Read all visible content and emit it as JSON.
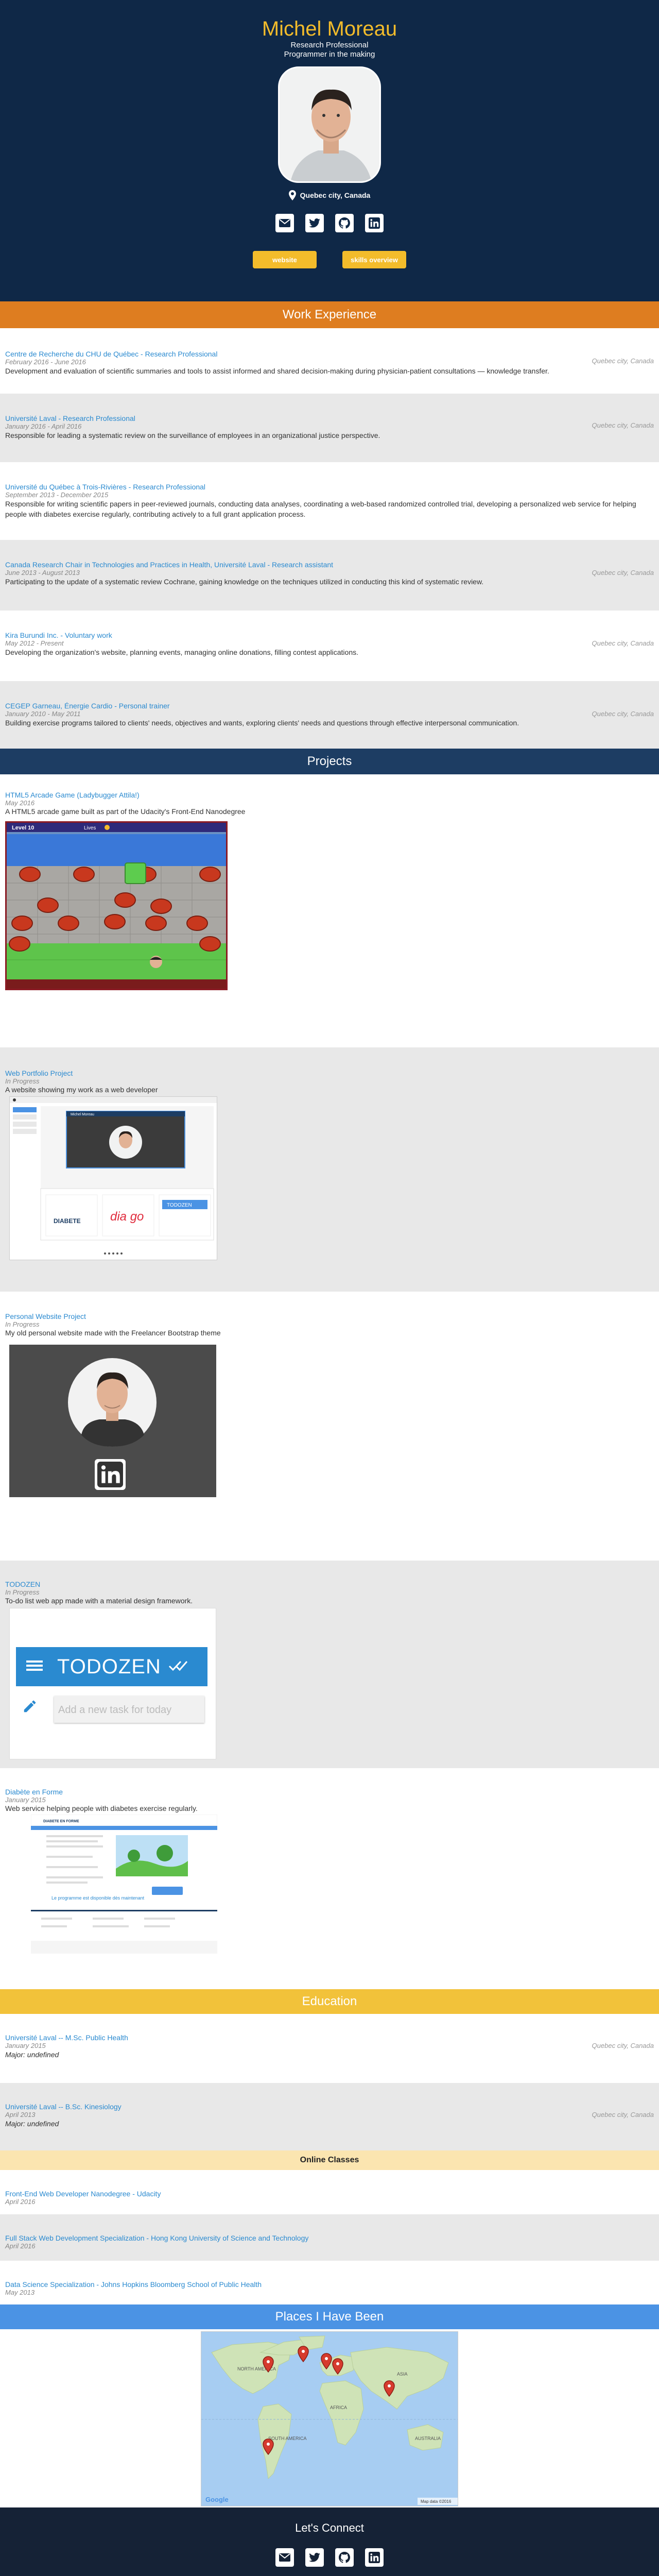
{
  "header": {
    "name": "Michel Moreau",
    "tagline1": "Research Professional",
    "tagline2": "Programmer in the making",
    "location": "Quebec city, Canada",
    "socials": [
      "email-icon",
      "twitter-icon",
      "github-icon",
      "linkedin-icon"
    ],
    "buttons": [
      "website",
      "skills overview"
    ]
  },
  "work": {
    "heading": "Work Experience",
    "items": [
      {
        "title": "Centre de Recherche du CHU de Québec - Research Professional",
        "date": "February 2016 - June 2016",
        "location": "Quebec city, Canada",
        "desc": "Development and evaluation of scientific summaries and tools to assist informed and shared decision-making during physician-patient consultations — knowledge transfer."
      },
      {
        "title": "Université Laval - Research Professional",
        "date": "January 2016 - April 2016",
        "location": "Quebec city, Canada",
        "desc": "Responsible for leading a systematic review on the surveillance of employees in an organizational justice perspective."
      },
      {
        "title": "Université du Québec à Trois-Rivières - Research Professional",
        "date": "September 2013 - December 2015",
        "location": "",
        "desc": "Responsible for writing scientific papers in peer-reviewed journals, conducting data analyses, coordinating a web-based randomized controlled trial, developing a personalized web service for helping people with diabetes exercise regularly, contributing actively to a full grant application process."
      },
      {
        "title": "Canada Research Chair in Technologies and Practices in Health, Université Laval - Research assistant",
        "date": "June 2013 - August 2013",
        "location": "Quebec city, Canada",
        "desc": "Participating to the update of a systematic review Cochrane, gaining knowledge on the techniques utilized in conducting this kind of systematic review."
      },
      {
        "title": "Kira Burundi Inc. - Voluntary work",
        "date": "May 2012 - Present",
        "location": "Quebec city, Canada",
        "desc": "Developing the organization's website, planning events, managing online donations, filling contest applications."
      },
      {
        "title": "CEGEP Garneau, Énergie Cardio - Personal trainer",
        "date": "January 2010 - May 2011",
        "location": "Quebec city, Canada",
        "desc": "Building exercise programs tailored to clients' needs, objectives and wants, exploring clients' needs and questions through effective interpersonal communication."
      }
    ]
  },
  "projects": {
    "heading": "Projects",
    "items": [
      {
        "title": "HTML5 Arcade Game (Ladybugger Attila!)",
        "status": "May 2016",
        "desc": "A HTML5 arcade game built as part of the Udacity's Front-End Nanodegree",
        "level": "Level 10",
        "lives": "Lives"
      },
      {
        "title": "Web Portfolio Project",
        "status": "In Progress",
        "desc": "A website showing my work as a web developer",
        "shot_header": "Michel Moreau",
        "shot_logo1": "DIABETE",
        "shot_logo2": "dia go",
        "shot_logo3": "TODOZEN"
      },
      {
        "title": "Personal Website Project",
        "status": "In Progress",
        "desc": "My old personal website made with the Freelancer Bootstrap theme"
      },
      {
        "title": "TODOZEN",
        "status": "In Progress",
        "desc": "To-do list web app made with a material design framework.",
        "app_title": "TODOZEN",
        "input_placeholder": "Add a new task for today"
      },
      {
        "title": "Diabète en Forme",
        "status": "January 2015",
        "desc": "Web service helping people with diabetes exercise regularly.",
        "shot_brand": "DIABETE EN FORME",
        "shot_text": "Le programme est disponible dès maintenant"
      }
    ]
  },
  "education": {
    "heading": "Education",
    "items": [
      {
        "title": "Université Laval -- M.Sc. Public Health",
        "date": "January 2015",
        "location": "Quebec city, Canada",
        "major": "Major: undefined"
      },
      {
        "title": "Université Laval -- B.Sc. Kinesiology",
        "date": "April 2013",
        "location": "Quebec city, Canada",
        "major": "Major: undefined"
      }
    ]
  },
  "online": {
    "heading": "Online Classes",
    "items": [
      {
        "title": "Front-End Web Developer Nanodegree - Udacity",
        "date": "April 2016"
      },
      {
        "title": "Full Stack Web Development Specialization - Hong Kong University of Science and Technology",
        "date": "April 2016"
      },
      {
        "title": "Data Science Specialization - Johns Hopkins Bloomberg School of Public Health",
        "date": "May 2013"
      }
    ]
  },
  "places": {
    "heading": "Places I Have Been",
    "map_labels": {
      "na": "NORTH AMERICA",
      "sa": "SOUTH AMERICA",
      "africa": "AFRICA",
      "asia": "ASIA",
      "aus": "AUSTRALIA",
      "brand": "Google",
      "credit": "Map data ©2016"
    }
  },
  "footer": {
    "heading": "Let's Connect"
  },
  "colors": {
    "navy": "#0f2847",
    "gold": "#f3bc2b",
    "orange": "#de7d20",
    "blue": "#4b93e4",
    "link": "#2a8ad0"
  }
}
